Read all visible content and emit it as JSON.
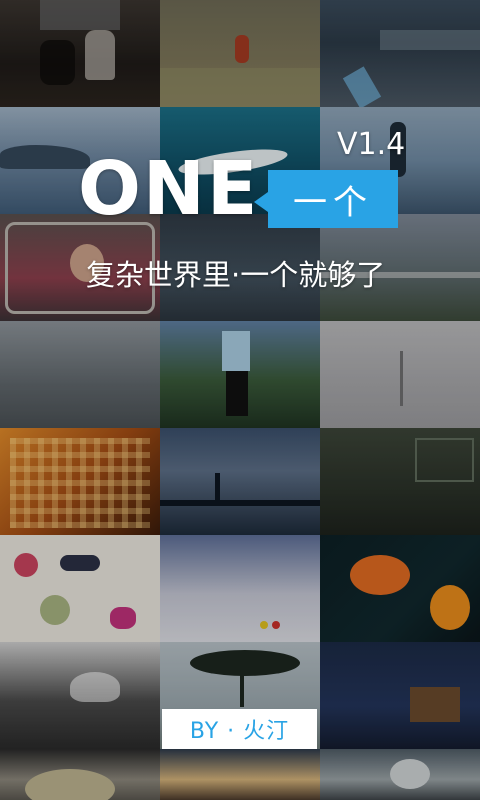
{
  "app": {
    "title": "ONE",
    "version": "V1.4",
    "badge_label": "一个",
    "tagline": "复杂世界里·一个就够了",
    "author_label": "BY · 火汀"
  },
  "theme": {
    "accent": "#29a3e5",
    "title_color": "#ffffff",
    "author_box_bg": "#ffffff"
  },
  "photo_tiles": [
    {
      "name": "photo-tile-elderly-couple"
    },
    {
      "name": "photo-tile-grass-field"
    },
    {
      "name": "photo-tile-market-stall"
    },
    {
      "name": "photo-tile-rocky-sea"
    },
    {
      "name": "photo-tile-whale"
    },
    {
      "name": "photo-tile-person-by-lake"
    },
    {
      "name": "photo-tile-train-window"
    },
    {
      "name": "photo-tile-street-night"
    },
    {
      "name": "photo-tile-road-field"
    },
    {
      "name": "photo-tile-grey-beach"
    },
    {
      "name": "photo-tile-mirror-field"
    },
    {
      "name": "photo-tile-foggy-tree"
    },
    {
      "name": "photo-tile-lattice-wall"
    },
    {
      "name": "photo-tile-bridge"
    },
    {
      "name": "photo-tile-abandoned-house"
    },
    {
      "name": "photo-tile-botanical-drawing"
    },
    {
      "name": "photo-tile-snowy-plain"
    },
    {
      "name": "photo-tile-goldfish"
    },
    {
      "name": "photo-tile-forest-bird"
    },
    {
      "name": "photo-tile-lone-tree"
    },
    {
      "name": "photo-tile-night-cabin"
    },
    {
      "name": "photo-tile-stone"
    },
    {
      "name": "photo-tile-street-scene"
    },
    {
      "name": "photo-tile-binoculars"
    }
  ]
}
